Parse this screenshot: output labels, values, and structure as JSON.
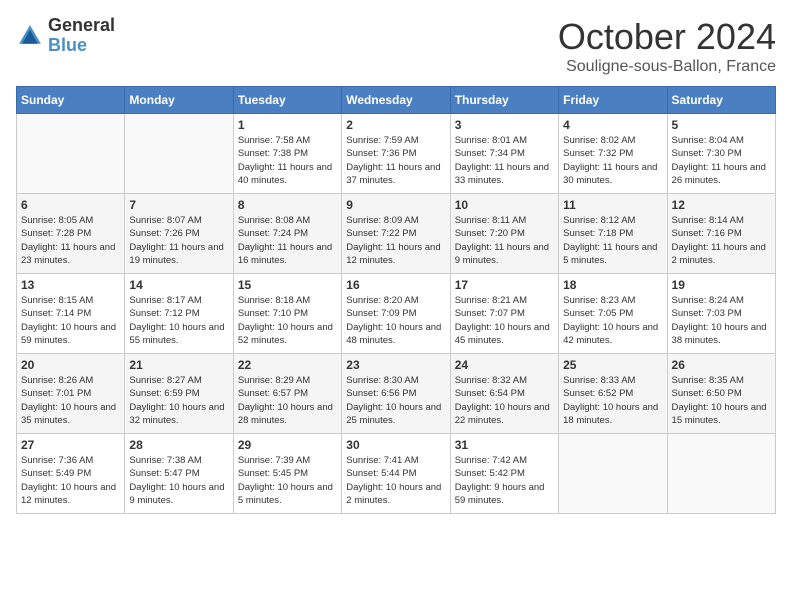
{
  "header": {
    "logo_general": "General",
    "logo_blue": "Blue",
    "month_title": "October 2024",
    "subtitle": "Souligne-sous-Ballon, France"
  },
  "columns": [
    "Sunday",
    "Monday",
    "Tuesday",
    "Wednesday",
    "Thursday",
    "Friday",
    "Saturday"
  ],
  "weeks": [
    [
      {
        "day": "",
        "sunrise": "",
        "sunset": "",
        "daylight": ""
      },
      {
        "day": "",
        "sunrise": "",
        "sunset": "",
        "daylight": ""
      },
      {
        "day": "1",
        "sunrise": "Sunrise: 7:58 AM",
        "sunset": "Sunset: 7:38 PM",
        "daylight": "Daylight: 11 hours and 40 minutes."
      },
      {
        "day": "2",
        "sunrise": "Sunrise: 7:59 AM",
        "sunset": "Sunset: 7:36 PM",
        "daylight": "Daylight: 11 hours and 37 minutes."
      },
      {
        "day": "3",
        "sunrise": "Sunrise: 8:01 AM",
        "sunset": "Sunset: 7:34 PM",
        "daylight": "Daylight: 11 hours and 33 minutes."
      },
      {
        "day": "4",
        "sunrise": "Sunrise: 8:02 AM",
        "sunset": "Sunset: 7:32 PM",
        "daylight": "Daylight: 11 hours and 30 minutes."
      },
      {
        "day": "5",
        "sunrise": "Sunrise: 8:04 AM",
        "sunset": "Sunset: 7:30 PM",
        "daylight": "Daylight: 11 hours and 26 minutes."
      }
    ],
    [
      {
        "day": "6",
        "sunrise": "Sunrise: 8:05 AM",
        "sunset": "Sunset: 7:28 PM",
        "daylight": "Daylight: 11 hours and 23 minutes."
      },
      {
        "day": "7",
        "sunrise": "Sunrise: 8:07 AM",
        "sunset": "Sunset: 7:26 PM",
        "daylight": "Daylight: 11 hours and 19 minutes."
      },
      {
        "day": "8",
        "sunrise": "Sunrise: 8:08 AM",
        "sunset": "Sunset: 7:24 PM",
        "daylight": "Daylight: 11 hours and 16 minutes."
      },
      {
        "day": "9",
        "sunrise": "Sunrise: 8:09 AM",
        "sunset": "Sunset: 7:22 PM",
        "daylight": "Daylight: 11 hours and 12 minutes."
      },
      {
        "day": "10",
        "sunrise": "Sunrise: 8:11 AM",
        "sunset": "Sunset: 7:20 PM",
        "daylight": "Daylight: 11 hours and 9 minutes."
      },
      {
        "day": "11",
        "sunrise": "Sunrise: 8:12 AM",
        "sunset": "Sunset: 7:18 PM",
        "daylight": "Daylight: 11 hours and 5 minutes."
      },
      {
        "day": "12",
        "sunrise": "Sunrise: 8:14 AM",
        "sunset": "Sunset: 7:16 PM",
        "daylight": "Daylight: 11 hours and 2 minutes."
      }
    ],
    [
      {
        "day": "13",
        "sunrise": "Sunrise: 8:15 AM",
        "sunset": "Sunset: 7:14 PM",
        "daylight": "Daylight: 10 hours and 59 minutes."
      },
      {
        "day": "14",
        "sunrise": "Sunrise: 8:17 AM",
        "sunset": "Sunset: 7:12 PM",
        "daylight": "Daylight: 10 hours and 55 minutes."
      },
      {
        "day": "15",
        "sunrise": "Sunrise: 8:18 AM",
        "sunset": "Sunset: 7:10 PM",
        "daylight": "Daylight: 10 hours and 52 minutes."
      },
      {
        "day": "16",
        "sunrise": "Sunrise: 8:20 AM",
        "sunset": "Sunset: 7:09 PM",
        "daylight": "Daylight: 10 hours and 48 minutes."
      },
      {
        "day": "17",
        "sunrise": "Sunrise: 8:21 AM",
        "sunset": "Sunset: 7:07 PM",
        "daylight": "Daylight: 10 hours and 45 minutes."
      },
      {
        "day": "18",
        "sunrise": "Sunrise: 8:23 AM",
        "sunset": "Sunset: 7:05 PM",
        "daylight": "Daylight: 10 hours and 42 minutes."
      },
      {
        "day": "19",
        "sunrise": "Sunrise: 8:24 AM",
        "sunset": "Sunset: 7:03 PM",
        "daylight": "Daylight: 10 hours and 38 minutes."
      }
    ],
    [
      {
        "day": "20",
        "sunrise": "Sunrise: 8:26 AM",
        "sunset": "Sunset: 7:01 PM",
        "daylight": "Daylight: 10 hours and 35 minutes."
      },
      {
        "day": "21",
        "sunrise": "Sunrise: 8:27 AM",
        "sunset": "Sunset: 6:59 PM",
        "daylight": "Daylight: 10 hours and 32 minutes."
      },
      {
        "day": "22",
        "sunrise": "Sunrise: 8:29 AM",
        "sunset": "Sunset: 6:57 PM",
        "daylight": "Daylight: 10 hours and 28 minutes."
      },
      {
        "day": "23",
        "sunrise": "Sunrise: 8:30 AM",
        "sunset": "Sunset: 6:56 PM",
        "daylight": "Daylight: 10 hours and 25 minutes."
      },
      {
        "day": "24",
        "sunrise": "Sunrise: 8:32 AM",
        "sunset": "Sunset: 6:54 PM",
        "daylight": "Daylight: 10 hours and 22 minutes."
      },
      {
        "day": "25",
        "sunrise": "Sunrise: 8:33 AM",
        "sunset": "Sunset: 6:52 PM",
        "daylight": "Daylight: 10 hours and 18 minutes."
      },
      {
        "day": "26",
        "sunrise": "Sunrise: 8:35 AM",
        "sunset": "Sunset: 6:50 PM",
        "daylight": "Daylight: 10 hours and 15 minutes."
      }
    ],
    [
      {
        "day": "27",
        "sunrise": "Sunrise: 7:36 AM",
        "sunset": "Sunset: 5:49 PM",
        "daylight": "Daylight: 10 hours and 12 minutes."
      },
      {
        "day": "28",
        "sunrise": "Sunrise: 7:38 AM",
        "sunset": "Sunset: 5:47 PM",
        "daylight": "Daylight: 10 hours and 9 minutes."
      },
      {
        "day": "29",
        "sunrise": "Sunrise: 7:39 AM",
        "sunset": "Sunset: 5:45 PM",
        "daylight": "Daylight: 10 hours and 5 minutes."
      },
      {
        "day": "30",
        "sunrise": "Sunrise: 7:41 AM",
        "sunset": "Sunset: 5:44 PM",
        "daylight": "Daylight: 10 hours and 2 minutes."
      },
      {
        "day": "31",
        "sunrise": "Sunrise: 7:42 AM",
        "sunset": "Sunset: 5:42 PM",
        "daylight": "Daylight: 9 hours and 59 minutes."
      },
      {
        "day": "",
        "sunrise": "",
        "sunset": "",
        "daylight": ""
      },
      {
        "day": "",
        "sunrise": "",
        "sunset": "",
        "daylight": ""
      }
    ]
  ]
}
